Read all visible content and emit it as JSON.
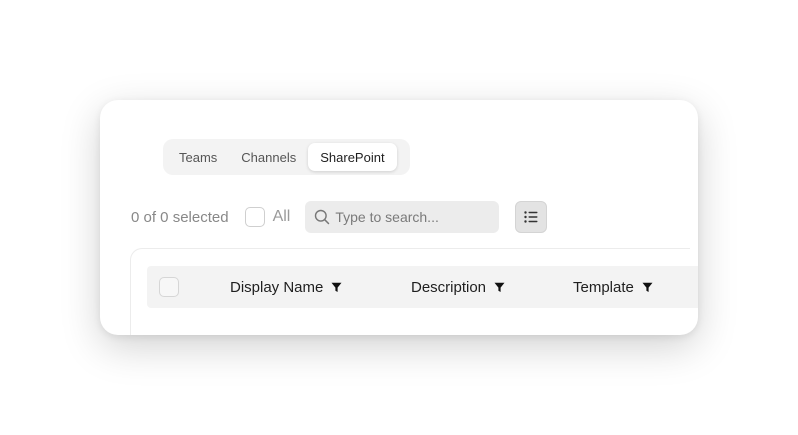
{
  "tabs": [
    {
      "label": "Teams",
      "active": false
    },
    {
      "label": "Channels",
      "active": false
    },
    {
      "label": "SharePoint",
      "active": true
    }
  ],
  "toolbar": {
    "selection_count": "0 of 0 selected",
    "all_label": "All",
    "search_placeholder": "Type to search...",
    "view_icon": "list-icon"
  },
  "table": {
    "columns": [
      {
        "label": "Display Name",
        "icon": "filter-icon"
      },
      {
        "label": "Description",
        "icon": "filter-icon"
      },
      {
        "label": "Template",
        "icon": "filter-icon"
      }
    ]
  }
}
